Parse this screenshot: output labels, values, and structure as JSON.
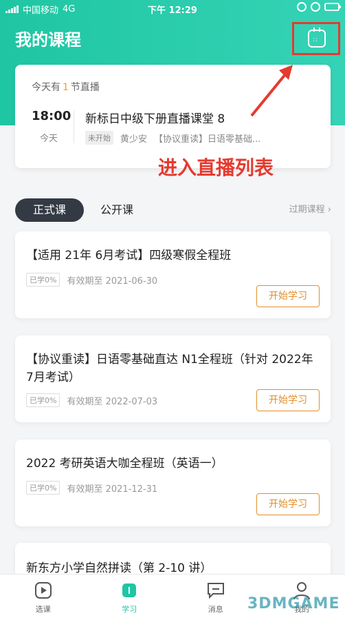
{
  "status_bar": {
    "carrier": "中国移动",
    "network": "4G",
    "time": "下午 12:29"
  },
  "header": {
    "title": "我的课程"
  },
  "live_card": {
    "count_prefix": "今天有",
    "count": "1",
    "count_suffix": "节直播",
    "time": "18:00",
    "day": "今天",
    "title": "新标日中级下册直播课堂 8",
    "status": "未开始",
    "teacher": "黄少安",
    "course": "【协议重读】日语零基础..."
  },
  "annotation": {
    "text": "进入直播列表"
  },
  "tabs": {
    "active": "正式课",
    "other": "公开课",
    "expired": "过期课程"
  },
  "courses": [
    {
      "title": "【适用 21年 6月考试】四级寒假全程班",
      "progress": "已学0%",
      "expiry": "有效期至 2021-06-30",
      "button": "开始学习"
    },
    {
      "title": "【协议重读】日语零基础直达 N1全程班（针对 2022年7月考试）",
      "progress": "已学0%",
      "expiry": "有效期至 2022-07-03",
      "button": "开始学习"
    },
    {
      "title": "2022 考研英语大咖全程班（英语一）",
      "progress": "已学0%",
      "expiry": "有效期至 2021-12-31",
      "button": "开始学习"
    },
    {
      "title": "新东方小学自然拼读（第 2-10 讲）"
    }
  ],
  "bottom_nav": [
    {
      "label": "选课",
      "icon": "play-icon"
    },
    {
      "label": "学习",
      "icon": "study-icon"
    },
    {
      "label": "消息",
      "icon": "message-icon"
    },
    {
      "label": "我的",
      "icon": "user-icon"
    }
  ],
  "watermark": "3DMGAME",
  "colors": {
    "primary": "#1fc6a3",
    "accent": "#e08f2a",
    "annotation": "#e53a2f"
  }
}
